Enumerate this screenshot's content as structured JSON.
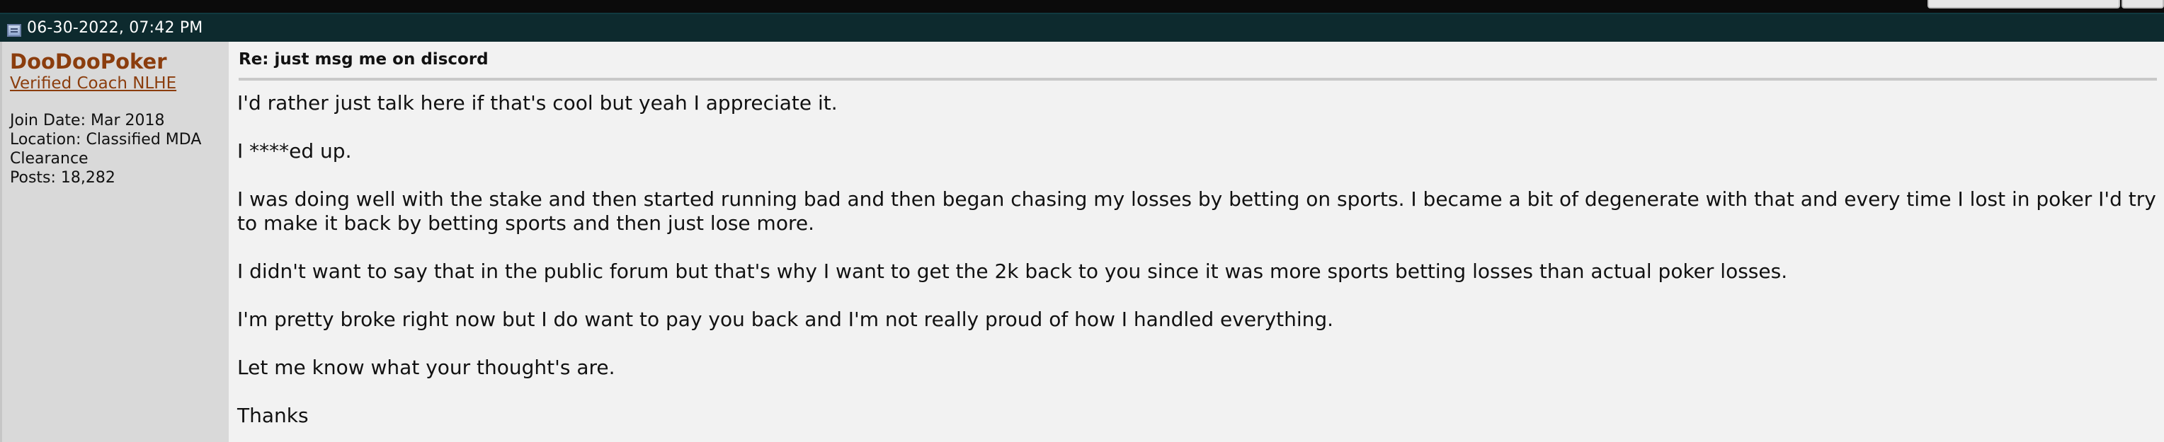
{
  "post": {
    "date": "06-30-2022, 07:42 PM",
    "user": {
      "name": "DooDooPoker",
      "title": "Verified Coach NLHE",
      "join_date": "Join Date: Mar 2018",
      "location": "Location: Classified MDA Clearance",
      "posts": "Posts: 18,282"
    },
    "title": "Re: just msg me on discord",
    "paragraphs": [
      "I'd rather just talk here if that's cool but yeah I appreciate it.",
      "I ****ed up.",
      "I was doing well with the stake and then started running bad and then began chasing my losses by betting on sports. I became a bit of degenerate with that and every time I lost in poker I'd try to make it back by betting sports and then just lose more.",
      "I didn't want to say that in the public forum but that's why I want to get the 2k back to you since it was more sports betting losses than actual poker losses.",
      "I'm pretty broke right now but I do want to pay you back and I'm not really proud of how I handled everything.",
      "Let me know what your thought's are.",
      "Thanks"
    ]
  },
  "icons": {
    "post_icon": "post-icon"
  },
  "colors": {
    "header_bg": "#0d2a2e",
    "username": "#8b3d0d",
    "user_col_bg": "#d9d9d9",
    "msg_bg": "#f2f2f2"
  }
}
